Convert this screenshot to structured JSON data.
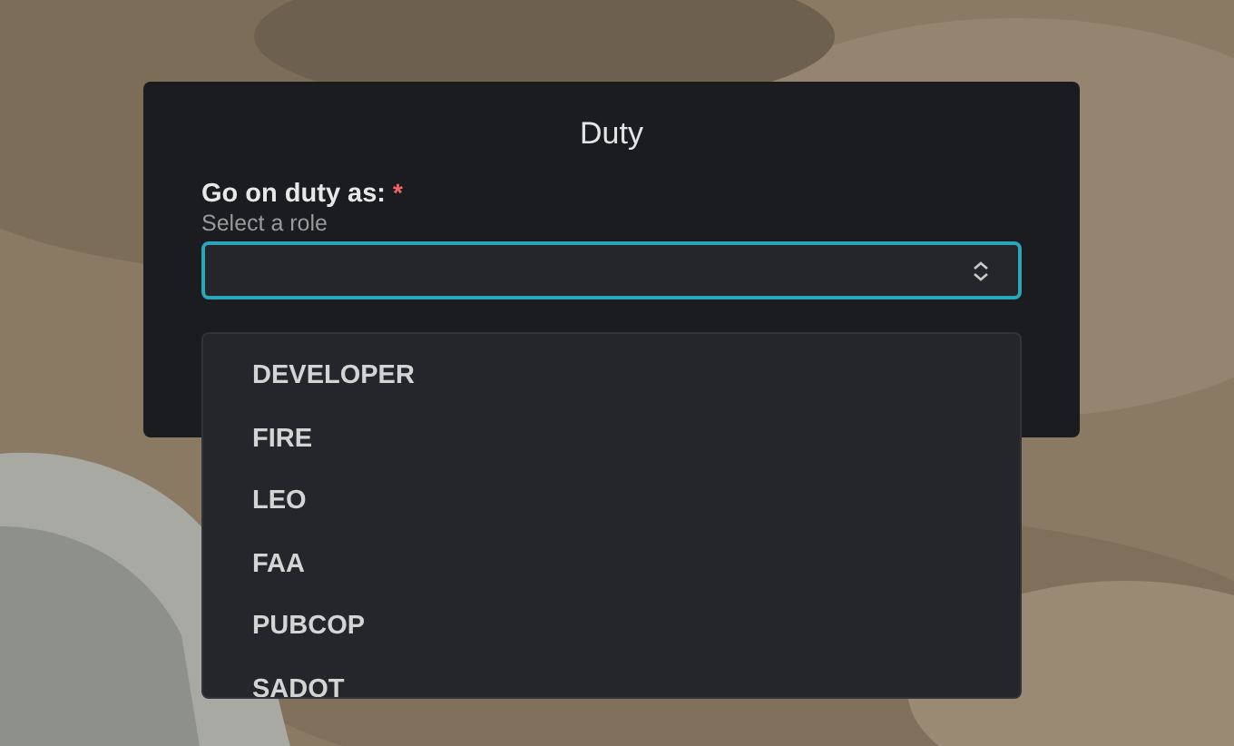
{
  "dialog": {
    "title": "Duty",
    "field": {
      "label": "Go on duty as:",
      "required_mark": "*",
      "hint": "Select a role",
      "open": true,
      "options": [
        {
          "label": "DEVELOPER",
          "selected": false
        },
        {
          "label": "FIRE",
          "selected": false
        },
        {
          "label": "LEO",
          "selected": false
        },
        {
          "label": "FAA",
          "selected": false
        },
        {
          "label": "PUBCOP",
          "selected": false
        },
        {
          "label": "SADOT",
          "selected": false
        }
      ]
    }
  }
}
